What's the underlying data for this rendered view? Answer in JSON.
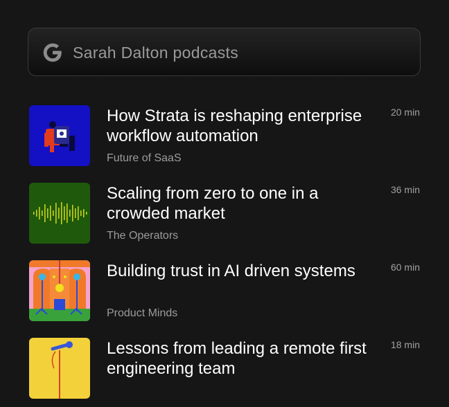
{
  "search": {
    "query": "Sarah Dalton podcasts",
    "icon": "google-g-icon"
  },
  "episodes": [
    {
      "title": "How Strata is reshaping enterprise workflow automation",
      "show": "Future of SaaS",
      "duration": "20 min",
      "thumb_bg": "#1410c4"
    },
    {
      "title": "Scaling from zero to one in a crowded market",
      "show": "The Operators",
      "duration": "36 min",
      "thumb_bg": "#1f5a0c"
    },
    {
      "title": "Building trust in AI driven systems",
      "show": "Product Minds",
      "duration": "60 min",
      "thumb_bg": "#f7a3cf"
    },
    {
      "title": "Lessons from leading a remote first engineering team",
      "show": "",
      "duration": "18 min",
      "thumb_bg": "#f3d13a"
    }
  ]
}
